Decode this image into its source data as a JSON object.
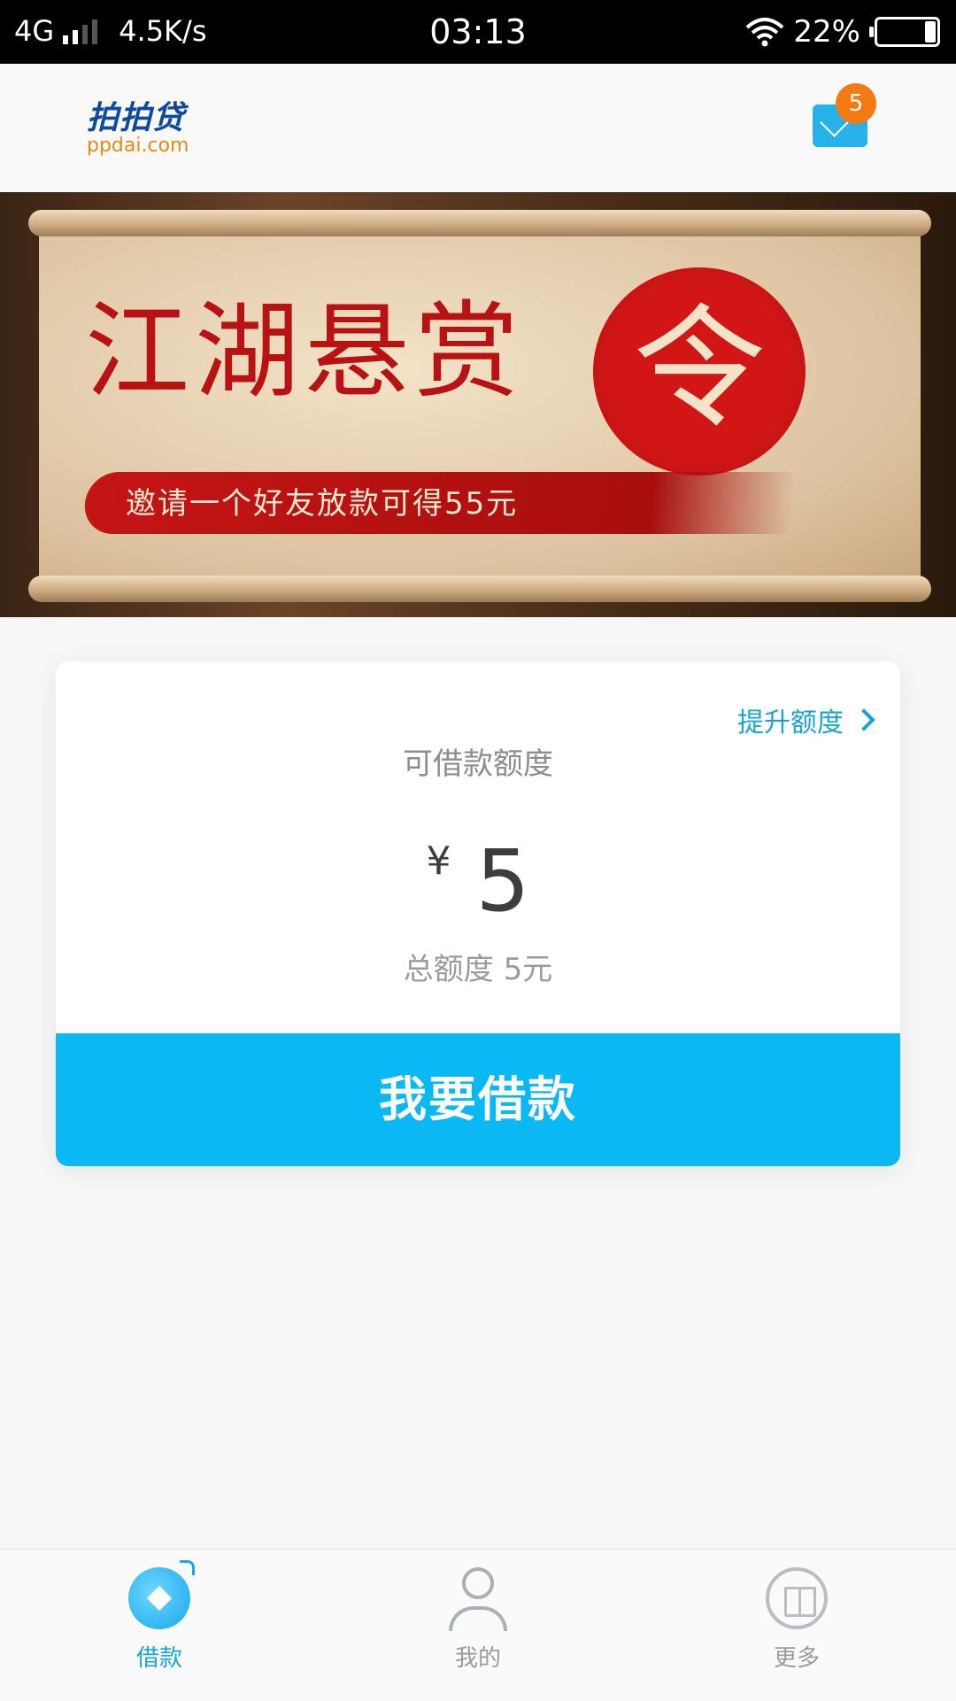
{
  "status_bar": {
    "network": "4G",
    "speed": "4.5K/s",
    "time": "03:13",
    "battery": "22%",
    "battery_level": 0.22
  },
  "header": {
    "logo_cn": "拍拍贷",
    "logo_en": "ppdai.com",
    "message_badge": "5",
    "icons": {
      "messages": "mail-icon"
    }
  },
  "banner": {
    "title": "江湖悬赏",
    "title_char": "令",
    "subtitle": "邀请一个好友放款可得55元"
  },
  "card": {
    "raise_limit": "提升额度",
    "available_label": "可借款额度",
    "currency": "¥",
    "amount": "5",
    "total_limit": "总额度 5元",
    "borrow_button": "我要借款"
  },
  "bottom_nav": {
    "items": [
      {
        "label": "借款",
        "icon": "loan-icon",
        "active": true
      },
      {
        "label": "我的",
        "icon": "user-icon",
        "active": false
      },
      {
        "label": "更多",
        "icon": "book-icon",
        "active": false
      }
    ]
  },
  "colors": {
    "accent": "#0ab8f4",
    "link": "#1aa3d8",
    "badge": "#f47b12",
    "banner_red": "#c51515"
  }
}
